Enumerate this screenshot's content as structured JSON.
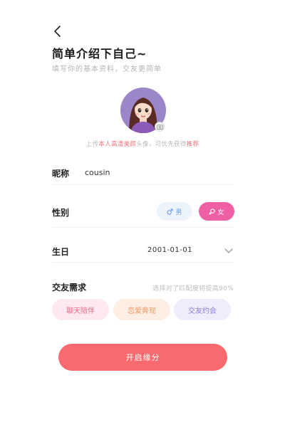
{
  "header": {
    "title": "简单介绍下自己~",
    "subtitle": "填写你的基本资料，交友更简单"
  },
  "avatar": {
    "hint_prefix": "上传",
    "hint_highlight_1": "本人高清美颜",
    "hint_middle": "头像，可优先获得",
    "hint_highlight_2": "推荐"
  },
  "form": {
    "nickname": {
      "label": "昵称",
      "value": "cousin"
    },
    "gender": {
      "label": "性别",
      "male_label": "男",
      "female_label": "女",
      "selected": "女"
    },
    "birthday": {
      "label": "生日",
      "value": "2001-01-01"
    },
    "needs": {
      "label": "交友需求",
      "hint": "选择对了匹配度将提高90%",
      "tags": [
        "聊天陪伴",
        "恋爱奔现",
        "交友约会"
      ]
    }
  },
  "actions": {
    "start_label": "开启缘分"
  },
  "colors": {
    "accent": "#f96a6e",
    "female": "#ef5fa3",
    "male": "#6e9ee0"
  }
}
